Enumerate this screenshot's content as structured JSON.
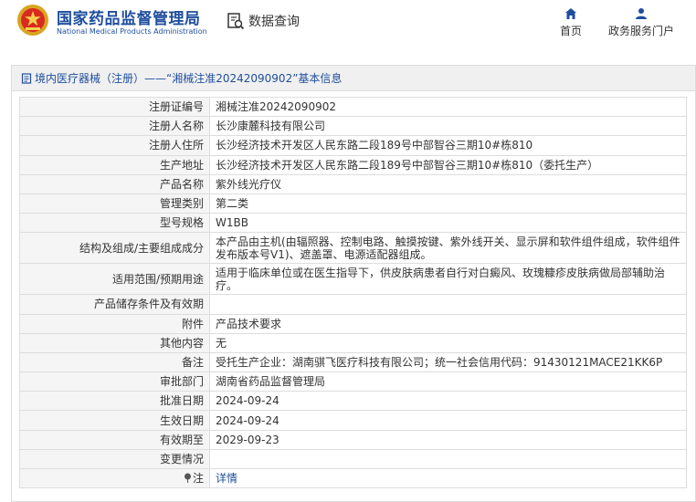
{
  "header": {
    "site_title": "国家药品监督管理局",
    "site_subtitle": "National Medical Products Administration",
    "query_label": "数据查询",
    "nav": [
      {
        "label": "首页",
        "icon": "home-icon"
      },
      {
        "label": "政务服务门户",
        "icon": "user-icon"
      }
    ]
  },
  "panel": {
    "title": "境内医疗器械（注册）——“湘械注准20242090902”基本信息"
  },
  "rows": [
    {
      "key": "注册证编号",
      "value": "湘械注准20242090902"
    },
    {
      "key": "注册人名称",
      "value": "长沙康麓科技有限公司"
    },
    {
      "key": "注册人住所",
      "value": "长沙经济技术开发区人民东路二段189号中部智谷三期10#栋810"
    },
    {
      "key": "生产地址",
      "value": "长沙经济技术开发区人民东路二段189号中部智谷三期10#栋810（委托生产）"
    },
    {
      "key": "产品名称",
      "value": "紫外线光疗仪"
    },
    {
      "key": "管理类别",
      "value": "第二类"
    },
    {
      "key": "型号规格",
      "value": "W1BB"
    },
    {
      "key": "结构及组成/主要组成成分",
      "value": "本产品由主机(由辐照器、控制电路、触摸按键、紫外线开关、显示屏和软件组件组成，软件组件发布版本号V1)、遮盖罩、电源适配器组成。"
    },
    {
      "key": "适用范围/预期用途",
      "value": "适用于临床单位或在医生指导下，供皮肤病患者自行对白癜风、玫瑰糠疹皮肤病做局部辅助治疗。"
    },
    {
      "key": "产品储存条件及有效期",
      "value": ""
    },
    {
      "key": "附件",
      "value": "产品技术要求"
    },
    {
      "key": "其他内容",
      "value": "无"
    },
    {
      "key": "备注",
      "value": "受托生产企业：湖南骐飞医疗科技有限公司；统一社会信用代码：91430121MACE21KK6P"
    },
    {
      "key": "审批部门",
      "value": "湖南省药品监督管理局"
    },
    {
      "key": "批准日期",
      "value": "2024-09-24"
    },
    {
      "key": "生效日期",
      "value": "2024-09-24"
    },
    {
      "key": "有效期至",
      "value": "2029-09-23"
    },
    {
      "key": "变更情况",
      "value": ""
    },
    {
      "key": "注",
      "value": "详情",
      "icon": "pin-icon"
    }
  ],
  "colors": {
    "brand_blue": "#1e4e9e",
    "header_bg": "#f0f0f0",
    "key_bg": "#f5f5f5",
    "border": "#dddddd"
  }
}
